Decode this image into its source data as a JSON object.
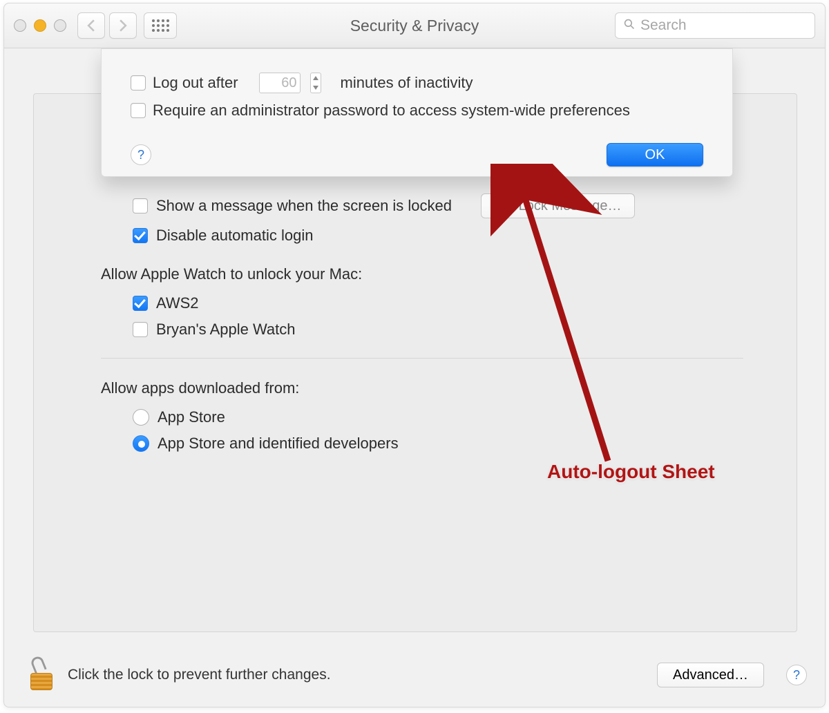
{
  "toolbar": {
    "title": "Security & Privacy",
    "search_placeholder": "Search"
  },
  "sheet": {
    "logout_prefix": "Log out after",
    "logout_minutes": "60",
    "logout_suffix": "minutes of inactivity",
    "require_admin": "Require an administrator password to access system-wide preferences",
    "help": "?",
    "ok": "OK"
  },
  "general": {
    "show_message": "Show a message when the screen is locked",
    "set_lock_message": "Set Lock Message…",
    "disable_auto_login": "Disable automatic login",
    "watch_heading": "Allow Apple Watch to unlock your Mac:",
    "watch1": "AWS2",
    "watch2": "Bryan's Apple Watch",
    "apps_heading": "Allow apps downloaded from:",
    "app_store": "App Store",
    "app_store_dev": "App Store and identified developers"
  },
  "footer": {
    "lock_text": "Click the lock to prevent further changes.",
    "advanced": "Advanced…",
    "help": "?"
  },
  "annotation": {
    "label": "Auto-logout Sheet"
  }
}
